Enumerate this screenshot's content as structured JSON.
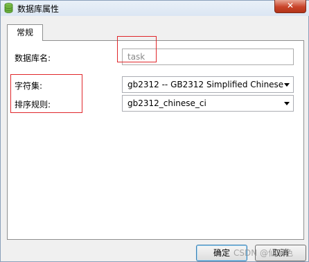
{
  "window": {
    "title": "数据库属性",
    "close_label": "✕"
  },
  "tabs": [
    {
      "label": "常规"
    }
  ],
  "form": {
    "db_name_label": "数据库名:",
    "db_name_value": "task",
    "charset_label": "字符集:",
    "charset_value": "gb2312 -- GB2312 Simplified Chinese",
    "collation_label": "排序规则:",
    "collation_value": "gb2312_chinese_ci"
  },
  "buttons": {
    "ok_label": "确定",
    "cancel_label": "取消"
  },
  "watermark": "CSDN @仙家色",
  "colors": {
    "highlight_box": "#e0262a",
    "title_bar": "#dbe6f3",
    "close_button": "#c9442a"
  }
}
